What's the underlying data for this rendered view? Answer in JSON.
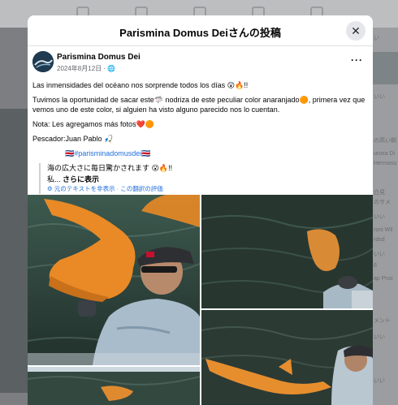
{
  "modal": {
    "title": "Parismina Domus Deiさんの投稿",
    "close_icon": "close-icon"
  },
  "post": {
    "author": "Parismina Domus Dei",
    "date": "2024年8月12日",
    "privacy_icon": "globe-icon",
    "more": "···",
    "paragraphs": [
      "Las inmensidades del océano nos sorprende todos los días 😮🔥!!",
      "Tuvimos la oportunidad de sacar este🦈 nodriza de este peculiar color anaranjado🟠, primera vez que vemos uno de este color, si alguien ha visto alguno parecido nos lo cuentan.",
      "Nota: Les agregamos más fotos❤️🟠",
      "Pescador:Juan Pablo 🎣"
    ],
    "hashtag": "🇨🇷#parisminadomusdei🇨🇷",
    "translation": {
      "text": "海の広大さに毎日驚かされます 😮🔥!!",
      "line2_prefix": "私...",
      "see_more": "さらに表示",
      "links": "⚙ 元のテキストを非表示 · この翻訳の評価"
    }
  },
  "background": {
    "right_snippets": [
      "い",
      "いい",
      "の高い朝",
      "uroxa Di",
      "Hermosu",
      "白見",
      "のサメ",
      "いい",
      "roni Wil",
      "rdsd",
      "いい",
      "6",
      "ap Proc",
      "メント",
      "いい",
      "いい"
    ]
  }
}
